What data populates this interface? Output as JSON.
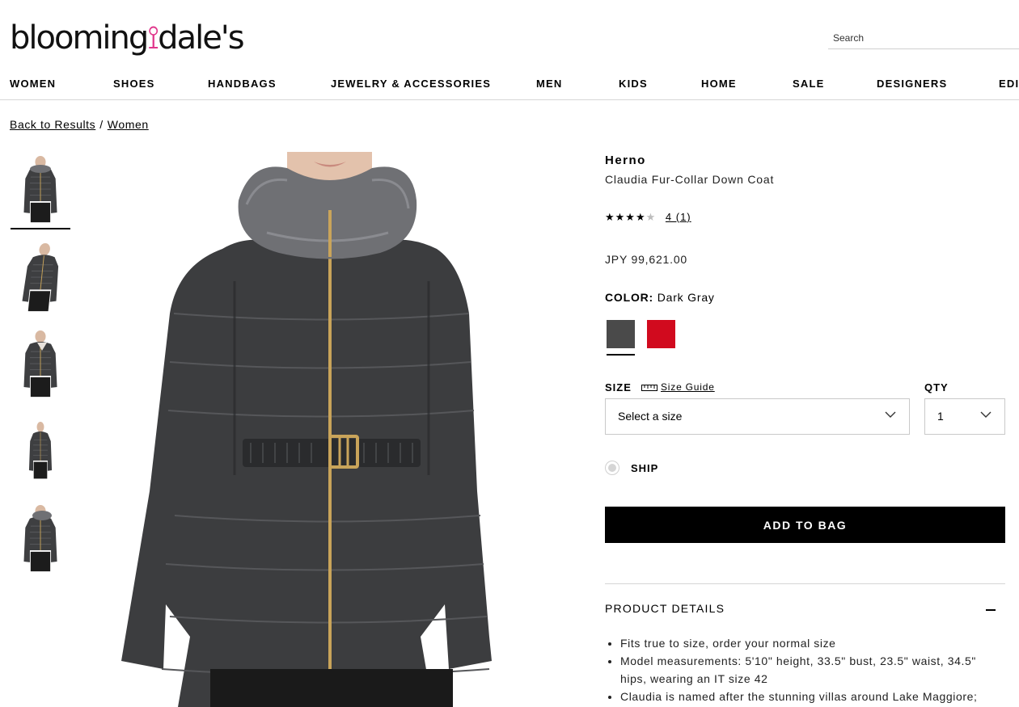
{
  "header": {
    "logo_text_before": "blooming",
    "logo_text_after": "dale's",
    "search_placeholder": "Search"
  },
  "nav": [
    {
      "label": "WOMEN"
    },
    {
      "label": "SHOES"
    },
    {
      "label": "HANDBAGS"
    },
    {
      "label": "JEWELRY & ACCESSORIES"
    },
    {
      "label": "MEN"
    },
    {
      "label": "KIDS"
    },
    {
      "label": "HOME"
    },
    {
      "label": "SALE"
    },
    {
      "label": "DESIGNERS"
    },
    {
      "label": "EDI"
    }
  ],
  "breadcrumb": {
    "back_label": "Back to Results",
    "separator": "/",
    "category": "Women"
  },
  "thumbnails": [
    {
      "view": "front-fur-collar",
      "selected": true
    },
    {
      "view": "side"
    },
    {
      "view": "front-open-collar"
    },
    {
      "view": "side-profile"
    },
    {
      "view": "back-three-quarter"
    }
  ],
  "product": {
    "brand": "Herno",
    "name": "Claudia Fur-Collar Down Coat",
    "rating_value": 4,
    "rating_max": 5,
    "stars_filled": "★★★★",
    "stars_empty": "★",
    "rating_link": "4 (1)",
    "price": "JPY 99,621.00",
    "color_label": "COLOR:",
    "color_value": "Dark Gray",
    "swatches": [
      {
        "name": "Dark Gray",
        "color": "#4a4a4a",
        "selected": true
      },
      {
        "name": "Red",
        "color": "#d10a1e"
      }
    ],
    "size_label": "SIZE",
    "size_guide": "Size Guide",
    "size_select": "Select a size",
    "qty_label": "QTY",
    "qty_value": "1",
    "ship_label": "SHIP",
    "add_to_bag": "ADD TO BAG",
    "details_title": "PRODUCT DETAILS",
    "details": [
      "Fits true to size, order your normal size",
      "Model measurements: 5'10\" height, 33.5\" bust, 23.5\" waist, 34.5\" hips, wearing an IT size 42",
      "Claudia is named after the stunning villas around Lake Maggiore;"
    ]
  },
  "colors": {
    "jacket": "#3c3d3f",
    "jacket_shadow": "#2a2b2d",
    "fur": "#6f7074",
    "zipper": "#c9a45a"
  }
}
